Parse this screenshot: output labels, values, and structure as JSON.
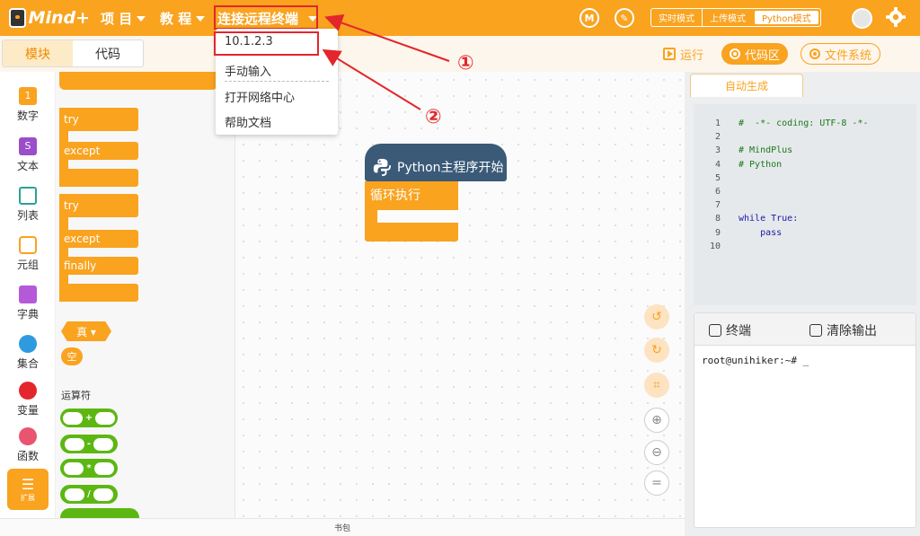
{
  "app": {
    "logo_text": "Mind+"
  },
  "topbar": {
    "menu_project": "项 目",
    "menu_tutorial": "教 程",
    "menu_connect": "连接远程终端",
    "modes": [
      "实时模式",
      "上传模式",
      "Python模式"
    ],
    "active_mode": "Python模式"
  },
  "dropdown": {
    "items": [
      "10.1.2.3",
      "手动输入",
      "打开网络中心",
      "帮助文档"
    ]
  },
  "annotations": {
    "step1": "①",
    "step2": "②"
  },
  "editor_tabs": {
    "blocks": "模块",
    "code": "代码"
  },
  "toolbar": {
    "run": "运行",
    "code_area": "代码区",
    "file_system": "文件系统"
  },
  "categories": [
    "数字",
    "文本",
    "列表",
    "元组",
    "字典",
    "集合",
    "变量",
    "函数",
    "扩展"
  ],
  "palette": {
    "try1": "try",
    "except1": "except",
    "try2": "try",
    "except2": "except",
    "finally": "finally",
    "true_label": "真 ▾",
    "none_label": "空",
    "operators_label": "运算符",
    "operators": [
      "+",
      "-",
      "*",
      "/"
    ]
  },
  "workspace": {
    "main_block": "Python主程序开始",
    "loop_block": "循环执行"
  },
  "code_panel": {
    "tab": "自动生成",
    "lines": [
      {
        "n": "1",
        "text": "#  -*- coding: UTF-8 -*-"
      },
      {
        "n": "2",
        "text": ""
      },
      {
        "n": "3",
        "text": "# MindPlus"
      },
      {
        "n": "4",
        "text": "# Python"
      },
      {
        "n": "5",
        "text": ""
      },
      {
        "n": "6",
        "text": ""
      },
      {
        "n": "7",
        "text": ""
      },
      {
        "n": "8",
        "text": "while True:"
      },
      {
        "n": "9",
        "text": "    pass"
      },
      {
        "n": "10",
        "text": ""
      }
    ]
  },
  "terminal": {
    "title": "终端",
    "clear": "清除输出",
    "prompt": "root@unihiker:~# _"
  },
  "bottom": {
    "backpack": "书包"
  },
  "colors": {
    "brand": "#f9a31f",
    "annotation": "#e3262b",
    "hat_block": "#3a5a78",
    "operator": "#5cb712"
  }
}
